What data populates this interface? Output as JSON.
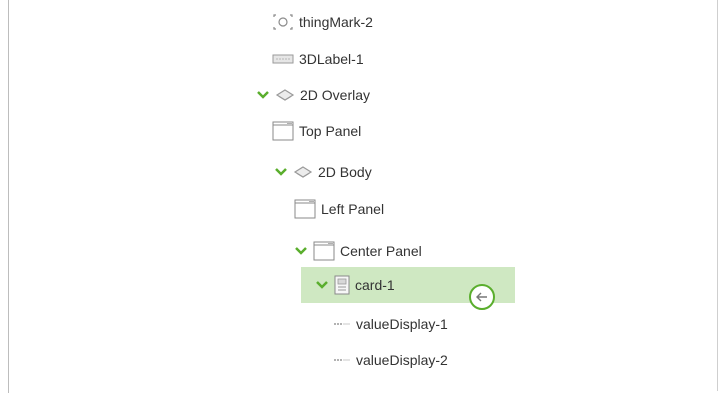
{
  "tree": {
    "items": [
      {
        "label": "thingMark-2",
        "icon": "thingmark-icon"
      },
      {
        "label": "3DLabel-1",
        "icon": "3d-label-icon"
      },
      {
        "label": "2D Overlay",
        "icon": "layers-icon",
        "expanded": true
      },
      {
        "label": "Top Panel",
        "icon": "panel-icon"
      },
      {
        "label": "2D Body",
        "icon": "layers-icon",
        "expanded": true
      },
      {
        "label": "Left Panel",
        "icon": "panel-icon"
      },
      {
        "label": "Center Panel",
        "icon": "panel-icon",
        "expanded": true
      },
      {
        "label": "card-1",
        "icon": "card-icon",
        "expanded": true,
        "selected": true
      },
      {
        "label": "valueDisplay-1",
        "icon": "value-display-icon"
      },
      {
        "label": "valueDisplay-2",
        "icon": "value-display-icon"
      }
    ],
    "selected_action_icon": "back-arrow-icon"
  },
  "colors": {
    "accent": "#5aae2d",
    "selected_bg": "#cfe8c2"
  }
}
